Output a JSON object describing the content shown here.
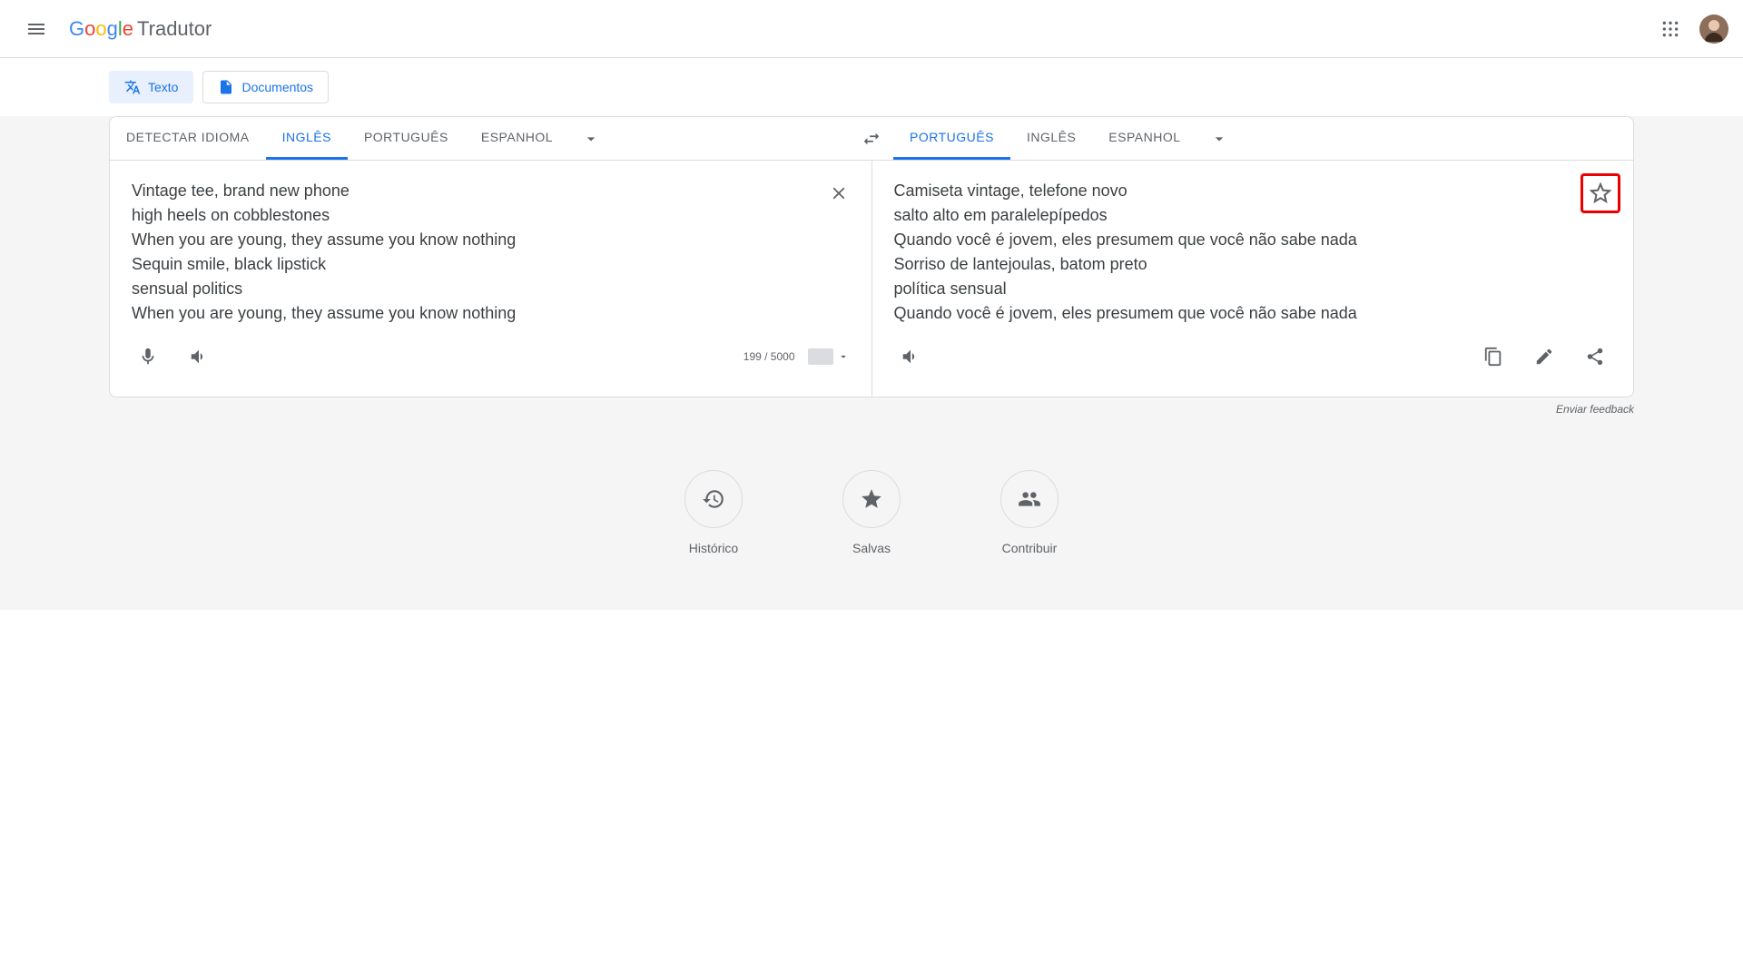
{
  "header": {
    "logo_chars": [
      "G",
      "o",
      "o",
      "g",
      "l",
      "e"
    ],
    "product": "Tradutor"
  },
  "chips": {
    "text": "Texto",
    "documents": "Documentos"
  },
  "source": {
    "detect": "DETECTAR IDIOMA",
    "tabs": [
      "INGLÊS",
      "PORTUGUÊS",
      "ESPANHOL"
    ],
    "active_index": 0,
    "text": "Vintage tee, brand new phone\nhigh heels on cobblestones\nWhen you are young, they assume you know nothing\nSequin smile, black lipstick\nsensual politics\nWhen you are young, they assume you know nothing",
    "char_count": "199 / 5000"
  },
  "target": {
    "tabs": [
      "PORTUGUÊS",
      "INGLÊS",
      "ESPANHOL"
    ],
    "active_index": 0,
    "text": "Camiseta vintage, telefone novo\nsalto alto em paralelepípedos\nQuando você é jovem, eles presumem que você não sabe nada\nSorriso de lantejoulas, batom preto\npolítica sensual\nQuando você é jovem, eles presumem que você não sabe nada"
  },
  "feedback": "Enviar feedback",
  "bottom": {
    "history": "Histórico",
    "saved": "Salvas",
    "contribute": "Contribuir"
  }
}
